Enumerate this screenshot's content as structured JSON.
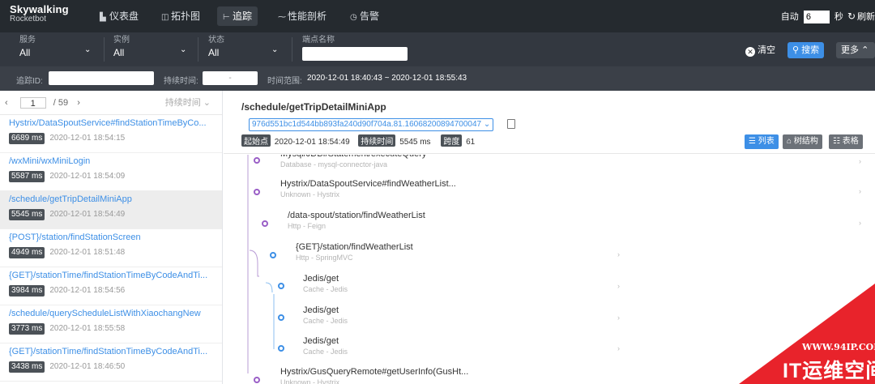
{
  "brand": {
    "line1": "Skywalking",
    "line2": "Rocketbot"
  },
  "nav": [
    {
      "label": "仪表盘",
      "icon": "dashboard-icon"
    },
    {
      "label": "拓扑图",
      "icon": "topology-icon"
    },
    {
      "label": "追踪",
      "icon": "trace-icon"
    },
    {
      "label": "性能剖析",
      "icon": "profile-icon"
    },
    {
      "label": "告警",
      "icon": "alarm-icon"
    }
  ],
  "auto_refresh": {
    "label": "自动",
    "interval": "6",
    "unit": "秒",
    "refresh": "刷新"
  },
  "filters": {
    "service": {
      "label": "服务",
      "value": "All"
    },
    "instance": {
      "label": "实例",
      "value": "All"
    },
    "state": {
      "label": "状态",
      "value": "All"
    },
    "endpoint": {
      "label": "端点名称",
      "value": ""
    },
    "clear": "清空",
    "search": "搜索",
    "more": "更多"
  },
  "filters2": {
    "trace_id_label": "追踪ID:",
    "duration_label": "持续时间:",
    "duration_sep": "-",
    "time_range_label": "时间范围:",
    "time_range": "2020-12-01 18:40:43 ~ 2020-12-01 18:55:43"
  },
  "pager": {
    "page": "1",
    "total": "/ 59",
    "sort": "持续时间"
  },
  "traces": [
    {
      "name": "Hystrix/DataSpoutService#findStationTimeByCo...",
      "duration": "6689 ms",
      "time": "2020-12-01 18:54:15"
    },
    {
      "name": "/wxMini/wxMiniLogin",
      "duration": "5587 ms",
      "time": "2020-12-01 18:54:09"
    },
    {
      "name": "/schedule/getTripDetailMiniApp",
      "duration": "5545 ms",
      "time": "2020-12-01 18:54:49"
    },
    {
      "name": "{POST}/station/findStationScreen",
      "duration": "4949 ms",
      "time": "2020-12-01 18:51:48"
    },
    {
      "name": "{GET}/stationTime/findStationTimeByCodeAndTi...",
      "duration": "3984 ms",
      "time": "2020-12-01 18:54:56"
    },
    {
      "name": "/schedule/queryScheduleListWithXiaochangNew",
      "duration": "3773 ms",
      "time": "2020-12-01 18:55:58"
    },
    {
      "name": "{GET}/stationTime/findStationTimeByCodeAndTi...",
      "duration": "3438 ms",
      "time": "2020-12-01 18:46:50"
    }
  ],
  "detail": {
    "title": "/schedule/getTripDetailMiniApp",
    "trace_id": "976d551bc1d544bb893fa240d90f704a.81.16068200894700047",
    "start_label": "起始点",
    "start": "2020-12-01 18:54:49",
    "duration_label": "持续时间",
    "duration": "5545 ms",
    "span_label": "跨度",
    "span_count": "61",
    "view_list": "列表",
    "view_tree": "树结构",
    "view_table": "表格"
  },
  "spans": [
    {
      "name": "Mysql/JDBI/Statement/executeQuery",
      "sub": "Database - mysql-connector-java"
    },
    {
      "name": "Hystrix/DataSpoutService#findWeatherList...",
      "sub": "Unknown - Hystrix"
    },
    {
      "name": "/data-spout/station/findWeatherList",
      "sub": "Http - Feign"
    },
    {
      "name": "{GET}/station/findWeatherList",
      "sub": "Http - SpringMVC"
    },
    {
      "name": "Jedis/get",
      "sub": "Cache - Jedis"
    },
    {
      "name": "Jedis/get",
      "sub": "Cache - Jedis"
    },
    {
      "name": "Jedis/get",
      "sub": "Cache - Jedis"
    },
    {
      "name": "Hystrix/GusQueryRemote#getUserInfo(GusHt...",
      "sub": "Unknown - Hystrix"
    }
  ],
  "watermark": {
    "url": "WWW.94IP.COM",
    "text": "IT运维空间"
  },
  "colors": {
    "topbar": "#252a2f",
    "accent": "#3d8fe6",
    "purple": "#9a5fc7",
    "blue": "#3d8fe6",
    "watermark": "#e8232b"
  }
}
